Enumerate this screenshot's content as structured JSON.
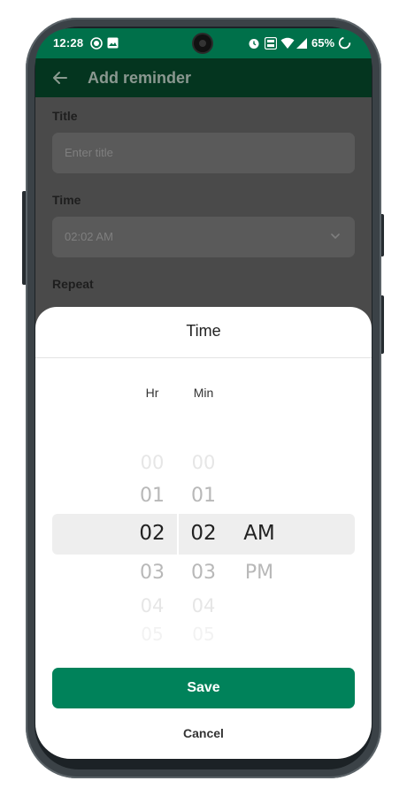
{
  "status_bar": {
    "time": "12:28",
    "battery": "65%",
    "icons": [
      "record-icon",
      "image-icon",
      "alarm-icon",
      "volte-icon",
      "wifi-icon",
      "signal-icon",
      "battery-saver-icon"
    ]
  },
  "app_bar": {
    "title": "Add reminder",
    "back_icon": "arrow-left-icon"
  },
  "form": {
    "title_label": "Title",
    "title_placeholder": "Enter title",
    "time_label": "Time",
    "time_value": "02:02 AM",
    "repeat_label": "Repeat"
  },
  "time_sheet": {
    "title": "Time",
    "hour_header": "Hr",
    "minute_header": "Min",
    "hours": [
      "00",
      "01",
      "02",
      "03",
      "04",
      "05"
    ],
    "minutes": [
      "00",
      "01",
      "02",
      "03",
      "04",
      "05"
    ],
    "selected_hour": "02",
    "selected_minute": "02",
    "period_selected": "AM",
    "period_other": "PM",
    "save_label": "Save",
    "cancel_label": "Cancel"
  },
  "colors": {
    "status_bar": "#00704a",
    "app_bar_dimmed": "#04351f",
    "primary_button": "#00825a",
    "sheet_background": "#ffffff",
    "picker_highlight": "#eeeeee"
  }
}
